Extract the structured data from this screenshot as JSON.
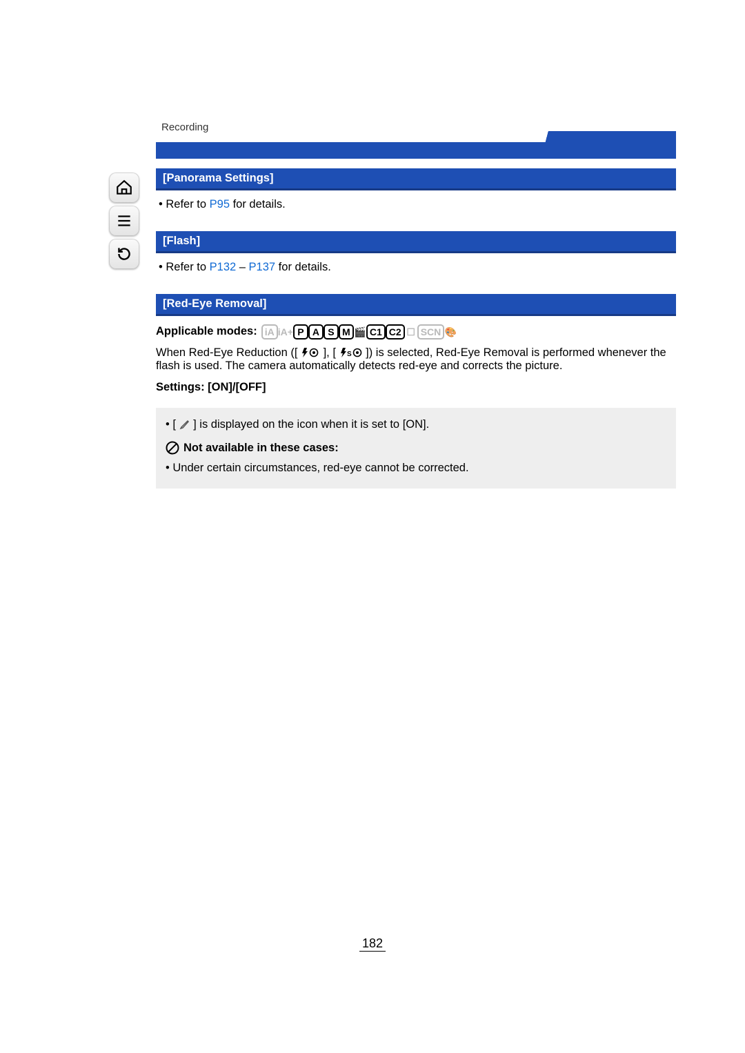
{
  "breadcrumb": "Recording",
  "sections": {
    "panorama": {
      "title": "[Panorama Settings]",
      "refer_prefix": "• Refer to ",
      "link": "P95",
      "refer_suffix": " for details."
    },
    "flash": {
      "title": "[Flash]",
      "refer_prefix": "• Refer to ",
      "link1": "P132",
      "dash": " – ",
      "link2": "P137",
      "refer_suffix": " for details."
    },
    "redeye": {
      "title": "[Red-Eye Removal]",
      "modes_label": "Applicable modes:",
      "para_a": "When Red-Eye Reduction ([ ",
      "para_b": " ], [ ",
      "para_c": " ]) is selected, Red-Eye Removal is performed whenever the flash is used. The camera automatically detects red-eye and corrects the picture.",
      "settings_line": "Settings: [ON]/[OFF]",
      "note_prefix": "• [ ",
      "note_suffix": " ] is displayed on the icon when it is set to [ON].",
      "na_title": "Not available in these cases:",
      "na_item": "• Under certain circumstances, red-eye cannot be corrected."
    }
  },
  "modes": [
    {
      "label": "iA",
      "dim": true,
      "title": "intelligent-auto"
    },
    {
      "label": "iA+",
      "dim": true,
      "noframe": true,
      "title": "intelligent-auto-plus"
    },
    {
      "label": "P",
      "dim": false,
      "title": "program"
    },
    {
      "label": "A",
      "dim": false,
      "title": "aperture"
    },
    {
      "label": "S",
      "dim": false,
      "title": "shutter"
    },
    {
      "label": "M",
      "dim": false,
      "title": "manual"
    },
    {
      "label": "🎬",
      "dim": true,
      "noframe": true,
      "title": "creative-video"
    },
    {
      "label": "C1",
      "dim": false,
      "title": "custom1"
    },
    {
      "label": "C2",
      "dim": false,
      "title": "custom2"
    },
    {
      "label": "☐",
      "dim": true,
      "noframe": true,
      "title": "panorama"
    },
    {
      "label": "SCN",
      "dim": true,
      "title": "scene"
    },
    {
      "label": "🎨",
      "dim": false,
      "noframe": true,
      "title": "creative-control"
    }
  ],
  "page_number": "182"
}
